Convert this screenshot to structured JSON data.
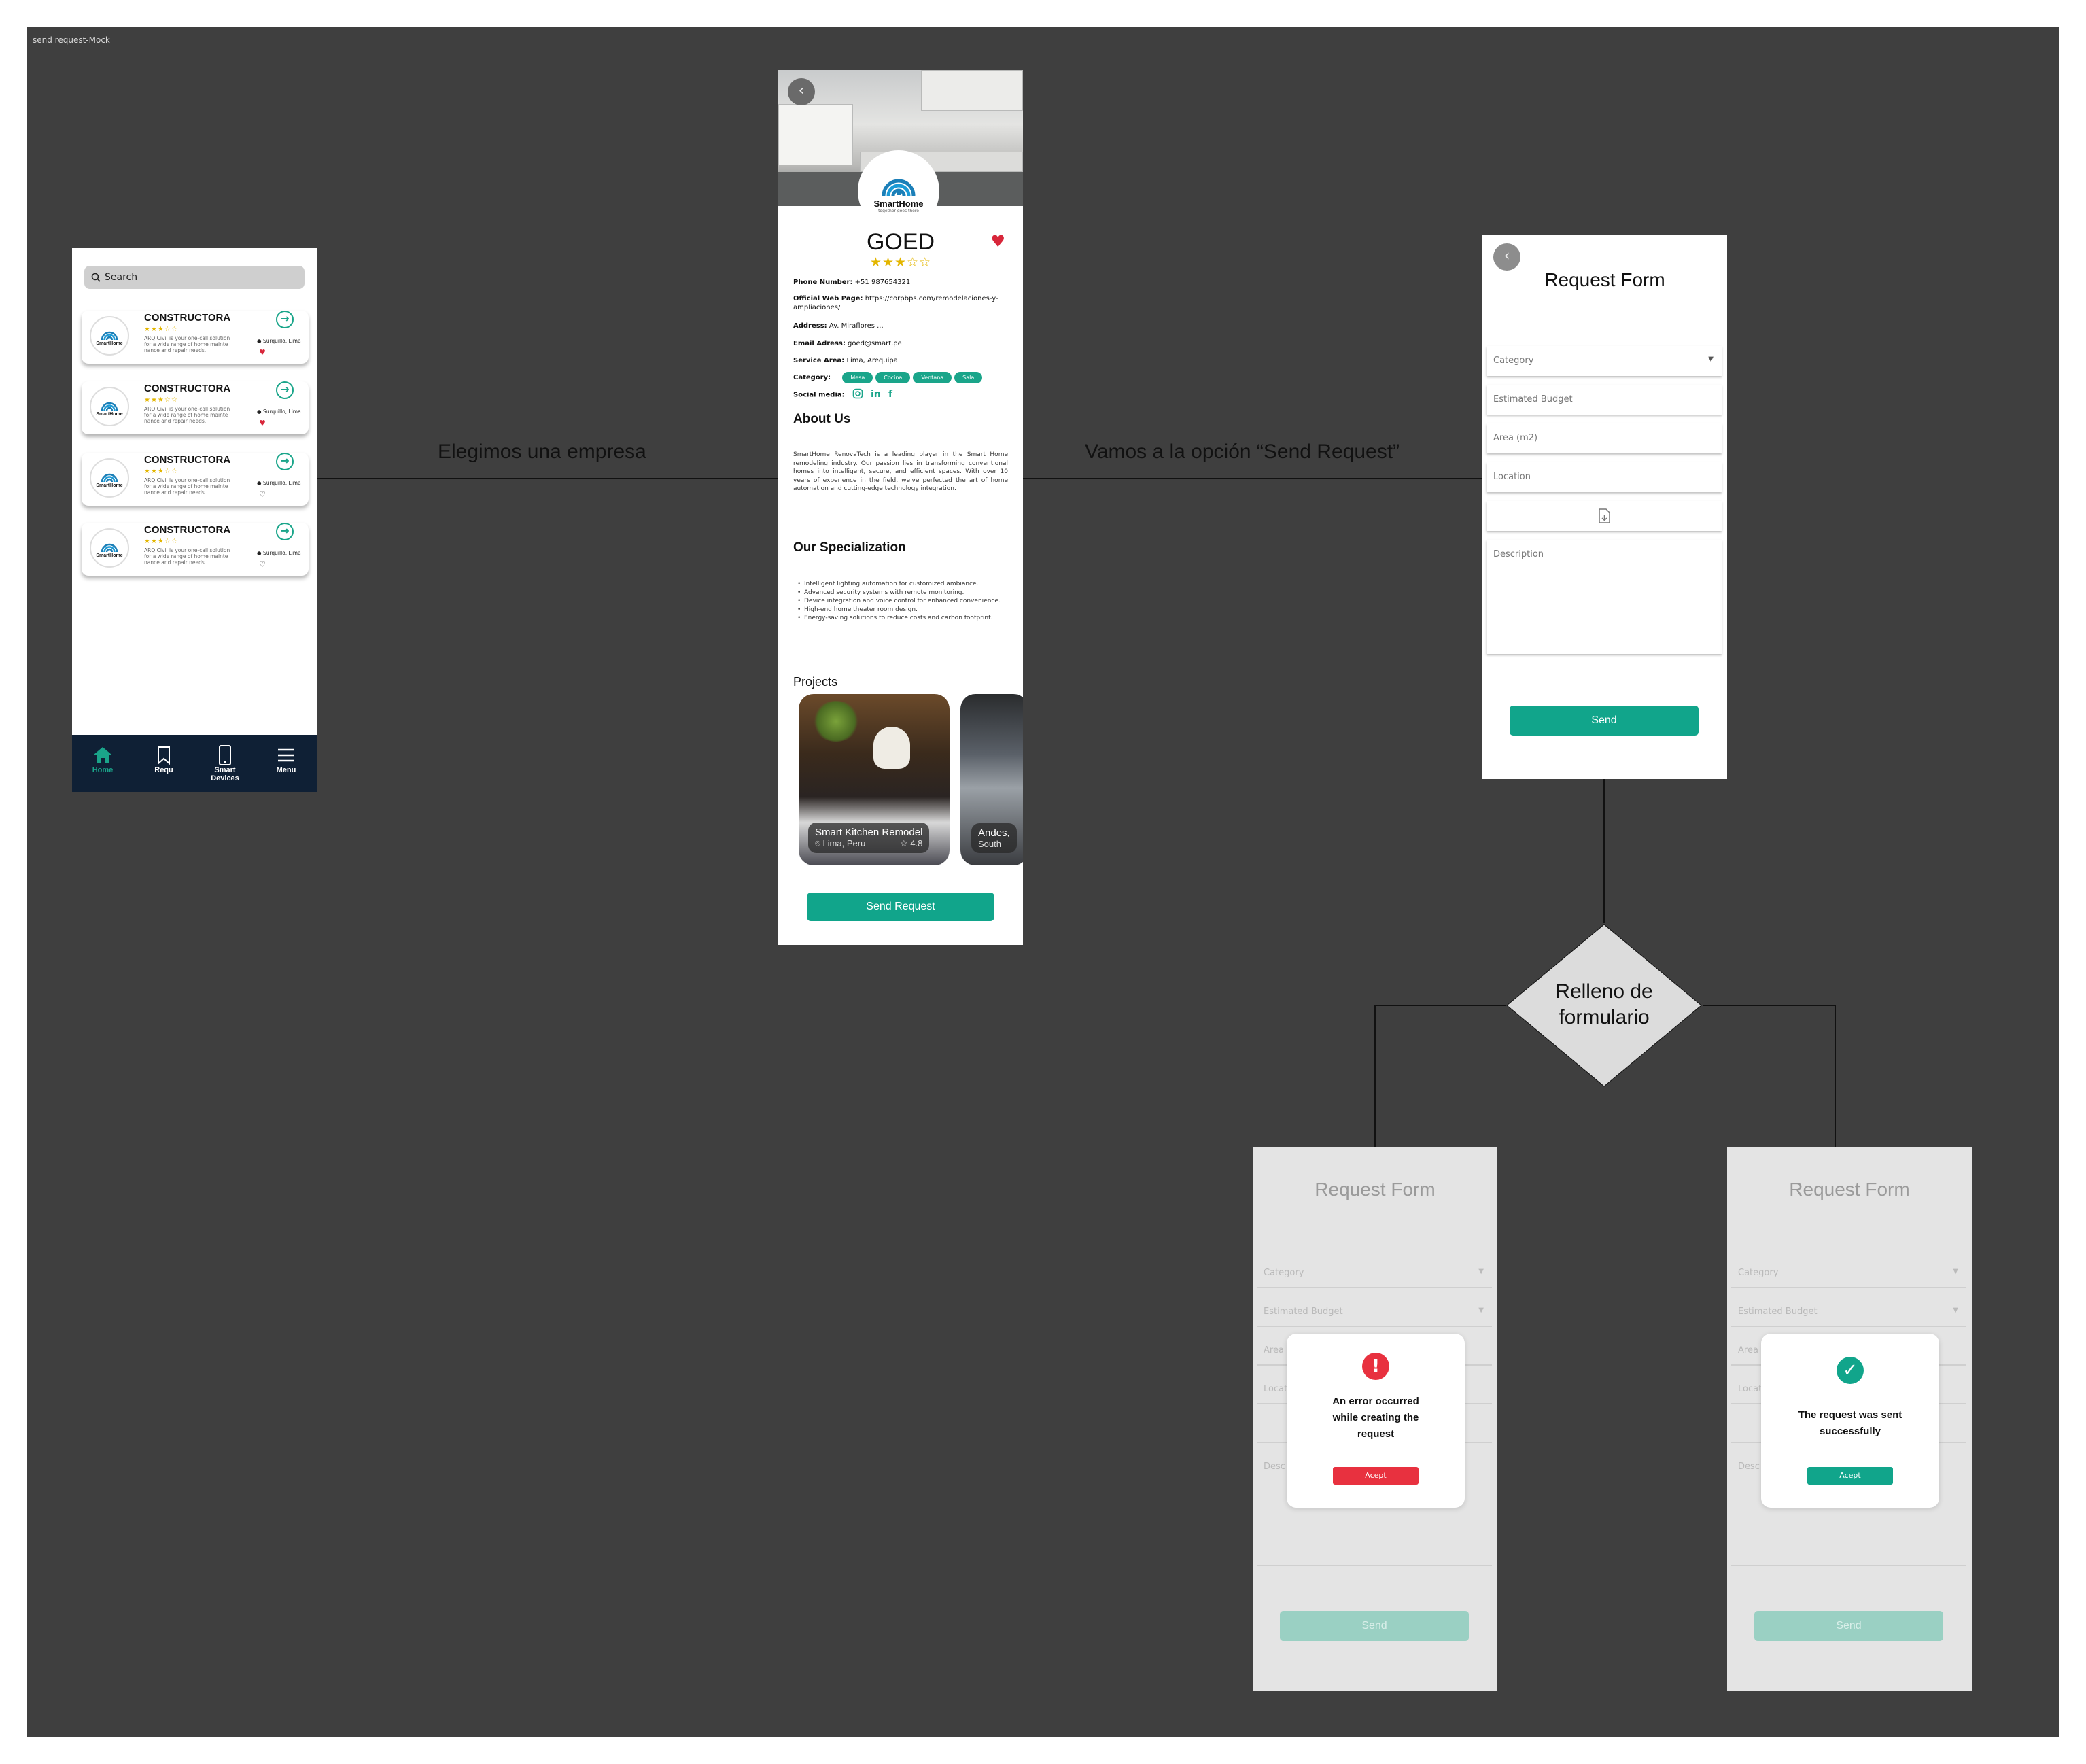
{
  "frame_title": "send request-Mock",
  "flow": {
    "label_1": "Elegimos una empresa",
    "label_2": "Vamos a la opción “Send Request”",
    "decision": [
      "Relleno de",
      "formulario"
    ]
  },
  "list_screen": {
    "search_placeholder": "Search",
    "cards": [
      {
        "name": "CONSTRUCTORA",
        "stars": "★★★☆☆",
        "desc": "ARQ Civil is your one-call solution for a wide range of home mainte nance and repair needs.",
        "location": "Surquillo, Lima",
        "favorite": true
      },
      {
        "name": "CONSTRUCTORA",
        "stars": "★★★☆☆",
        "desc": "ARQ Civil is your one-call solution for a wide range of home mainte nance and repair needs.",
        "location": "Surquillo, Lima",
        "favorite": true
      },
      {
        "name": "CONSTRUCTORA",
        "stars": "★★★☆☆",
        "desc": "ARQ Civil is your one-call solution for a wide range of home mainte nance and repair needs.",
        "location": "Surquillo, Lima",
        "favorite": false
      },
      {
        "name": "CONSTRUCTORA",
        "stars": "★★★☆☆",
        "desc": "ARQ Civil is your one-call solution for a wide range of home mainte nance and repair needs.",
        "location": "Surquillo, Lima",
        "favorite": false
      }
    ],
    "logo_text": "SmartHome",
    "tabs": [
      "Home",
      "Requ",
      "Smart Devices",
      "Menu"
    ],
    "active_tab": "Home"
  },
  "detail_screen": {
    "logo_name": "SmartHome",
    "logo_tagline": "together goes there",
    "company": "GOED",
    "stars": "★★★☆☆",
    "phone_label": "Phone Number:",
    "phone": "+51 987654321",
    "web_label": "Official Web Page:",
    "web": "https://corpbps.com/remodelaciones-y-ampliaciones/",
    "address_label": "Address:",
    "address": "Av. Miraflores ...",
    "email_label": "Email Adress:",
    "email": "goed@smart.pe",
    "service_label": "Service Area:",
    "service": "Lima, Arequipa",
    "category_label": "Category:",
    "categories": [
      "Mesa",
      "Cocina",
      "Ventana",
      "Sala"
    ],
    "social_label": "Social media:",
    "about_title": "About Us",
    "about_text": "SmartHome RenovaTech is a leading player in the Smart Home remodeling industry. Our passion lies in transforming conventional homes into intelligent, secure, and efficient spaces. With over 10 years of experience in the field, we've perfected the art of home automation and cutting-edge technology integration.",
    "spec_title": "Our Specialization",
    "specializations": [
      "Intelligent lighting automation for customized ambiance.",
      "Advanced security systems with remote monitoring.",
      "Device integration and voice control for enhanced convenience.",
      "High-end home theater room design.",
      "Energy-saving solutions to reduce costs and carbon footprint."
    ],
    "projects_title": "Projects",
    "projects": [
      {
        "title": "Smart Kitchen Remodel",
        "location": "Lima, Peru",
        "rating": "4.8"
      },
      {
        "title": "Andes,",
        "location": "South"
      }
    ],
    "send_button": "Send Request"
  },
  "form_screen": {
    "title": "Request Form",
    "category": "Category",
    "budget": "Estimated Budget",
    "area": "Area (m2)",
    "location": "Location",
    "description": "Description",
    "send": "Send"
  },
  "result_screens": {
    "title": "Request Form",
    "category": "Category",
    "budget": "Estimated Budget",
    "area_short": "Area",
    "loc_short": "Locat",
    "desc_short": "Desc",
    "send": "Send",
    "error": {
      "message": "An error occurred while creating the request",
      "button": "Acept",
      "color": "#e8313f"
    },
    "success": {
      "message": "The request was sent successfully",
      "button": "Acept",
      "color": "#11a58b"
    }
  },
  "colors": {
    "accent": "#11a58b",
    "error": "#e8313f",
    "nav": "#0f2035",
    "canvas": "#3f3f3f"
  }
}
